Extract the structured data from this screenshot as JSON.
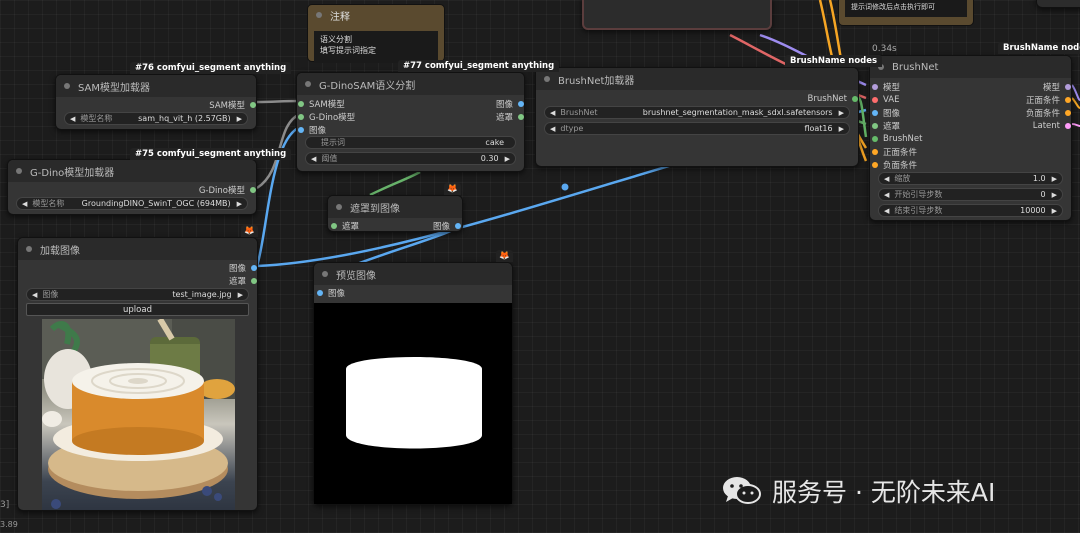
{
  "colors": {
    "model_port": "#b39ddb",
    "image_port": "#64b5f6",
    "mask_port": "#81c784",
    "vae_port": "#ff6e6e",
    "conditioning_port": "#ffa726",
    "latent_port": "#ff9cf9",
    "brushnet_port": "#66bb6a",
    "sam_port": "#81c784",
    "wire_image": "#5aa8f0",
    "wire_mask": "#67b26a",
    "wire_gray": "#8b8b8b",
    "wire_orange": "#f5a524",
    "wire_red": "#e06666",
    "wire_purple": "#9e8cf0"
  },
  "top_note": {
    "title": "注释",
    "lines": [
      "语义分割",
      "填写提示词指定"
    ]
  },
  "badges": {
    "sam": "#76 comfyui_segment anything",
    "gdino": "#75 comfyui_segment anything",
    "gdinosam": "#77 comfyui_segment anything",
    "brushnet_loader": "BrushName nodes",
    "brushnet": "BrushName nodes",
    "small_icon": "🦊"
  },
  "sam_loader": {
    "title": "SAM模型加载器",
    "output": "SAM模型",
    "widget_label": "模型名称",
    "widget_value": "sam_hq_vit_h (2.57GB)"
  },
  "gdino_loader": {
    "title": "G-Dino模型加载器",
    "output": "G-Dino模型",
    "widget_label": "模型名称",
    "widget_value": "GroundingDINO_SwinT_OGC (694MB)"
  },
  "gdinosam": {
    "title": "G-DinoSAM语义分割",
    "inputs": [
      "SAM模型",
      "G-Dino模型",
      "图像"
    ],
    "outputs": [
      "图像",
      "遮罩"
    ],
    "prompt_label": "提示词",
    "prompt_value": "cake",
    "threshold_label": "阈值",
    "threshold_value": "0.30"
  },
  "brushnet_loader": {
    "title": "BrushNet加载器",
    "output": "BrushNet",
    "widget1_label": "BrushNet",
    "widget1_value": "brushnet_segmentation_mask_sdxl.safetensors",
    "widget2_label": "dtype",
    "widget2_value": "float16"
  },
  "mask_to_image": {
    "title": "遮罩到图像",
    "input": "遮罩",
    "output": "图像"
  },
  "load_image": {
    "title": "加载图像",
    "outputs": [
      "图像",
      "遮罩"
    ],
    "widget_label": "图像",
    "widget_value": "test_image.jpg",
    "upload_label": "upload"
  },
  "preview_image": {
    "title": "预览图像",
    "input": "图像"
  },
  "brushnet": {
    "time": "0.34s",
    "title": "BrushNet",
    "inputs": [
      "模型",
      "VAE",
      "图像",
      "遮罩",
      "BrushNet",
      "正面条件",
      "负面条件"
    ],
    "outputs": [
      "模型",
      "正面条件",
      "负面条件",
      "Latent"
    ],
    "widgets": [
      {
        "label": "缩放",
        "value": "1.0"
      },
      {
        "label": "开始引导步数",
        "value": "0"
      },
      {
        "label": "结束引导步数",
        "value": "10000"
      }
    ]
  },
  "top_right_note": {
    "text": "提示词修改后点击执行即可"
  },
  "edge_labels": {
    "left_bracket": "3]",
    "bottom_left": "3.89"
  },
  "watermark": {
    "text": "服务号 · 无阶未来AI",
    "icon": "wechat-icon"
  }
}
